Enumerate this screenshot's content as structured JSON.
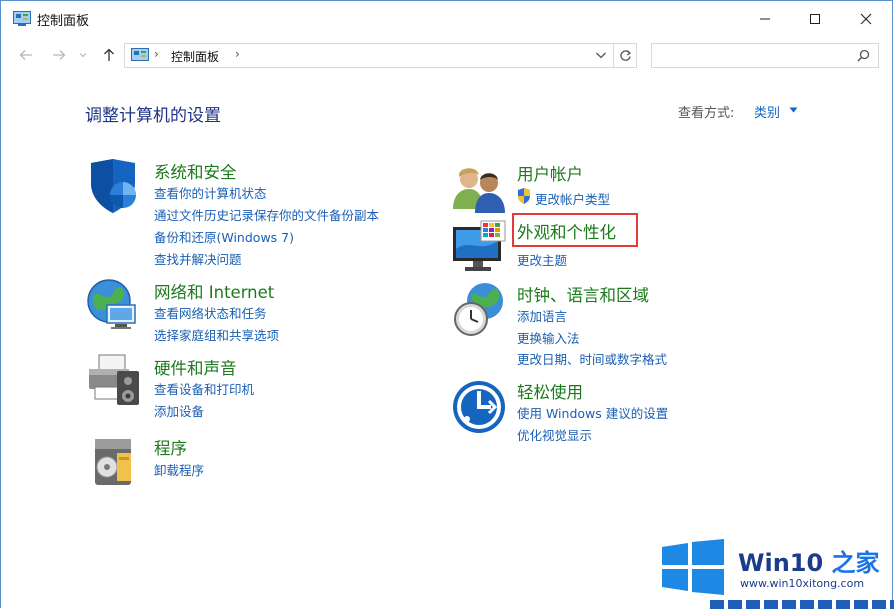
{
  "window": {
    "title": "控制面板"
  },
  "address": {
    "crumb": "控制面板",
    "sep1": "›",
    "sep2": "›",
    "search_placeholder": ""
  },
  "header": {
    "title": "调整计算机的设置",
    "view_by_label": "查看方式:",
    "view_by_value": "类别"
  },
  "categories": {
    "system": {
      "title": "系统和安全",
      "links": [
        "查看你的计算机状态",
        "通过文件历史记录保存你的文件备份副本",
        "备份和还原(Windows 7)",
        "查找并解决问题"
      ]
    },
    "network": {
      "title": "网络和 Internet",
      "links": [
        "查看网络状态和任务",
        "选择家庭组和共享选项"
      ]
    },
    "hardware": {
      "title": "硬件和声音",
      "links": [
        "查看设备和打印机",
        "添加设备"
      ]
    },
    "programs": {
      "title": "程序",
      "links": [
        "卸载程序"
      ]
    },
    "users": {
      "title": "用户帐户",
      "links": [
        "更改帐户类型"
      ]
    },
    "appearance": {
      "title": "外观和个性化",
      "links": [
        "更改主题"
      ]
    },
    "clock": {
      "title": "时钟、语言和区域",
      "links": [
        "添加语言",
        "更换输入法",
        "更改日期、时间或数字格式"
      ]
    },
    "ease": {
      "title": "轻松使用",
      "links": [
        "使用 Windows 建议的设置",
        "优化视觉显示"
      ]
    }
  },
  "watermark": {
    "brand": "Win10",
    "brand_zh": "之家",
    "url": "www.win10xitong.com"
  },
  "colors": {
    "title_blue": "#1e3287",
    "category_green": "#1c7a1c",
    "link_blue": "#1a5fb4",
    "highlight_red": "#e53935"
  }
}
